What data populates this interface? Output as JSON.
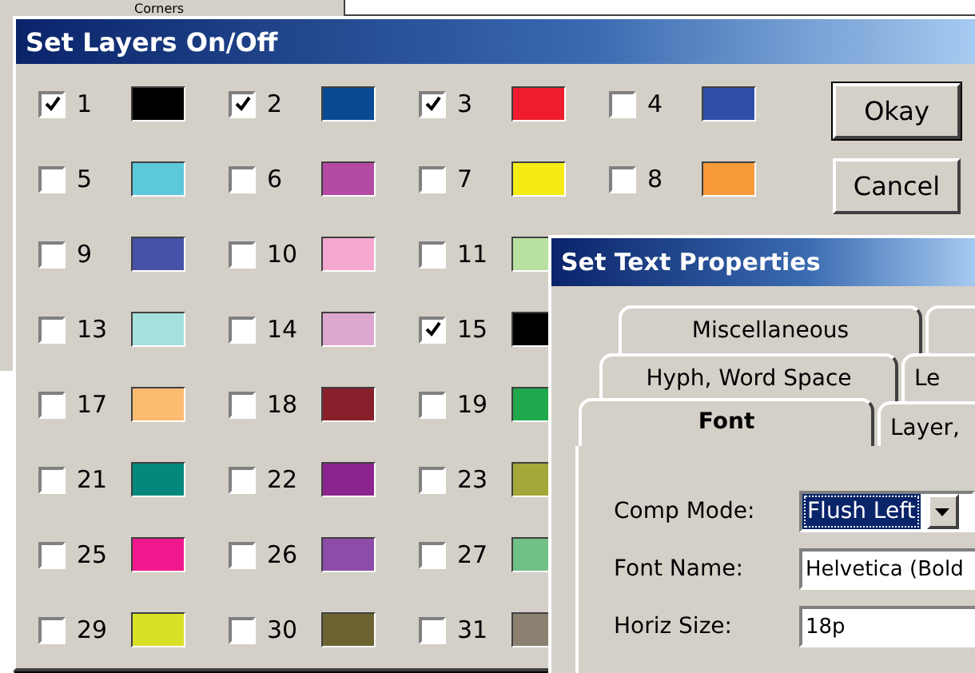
{
  "backdrop": {
    "label": "Corners"
  },
  "layers_dialog": {
    "title": "Set Layers On/Off",
    "rows": [
      [
        {
          "number": "1",
          "checked": true,
          "color": "#000000"
        },
        {
          "number": "2",
          "checked": true,
          "color": "#0a4a94"
        },
        {
          "number": "3",
          "checked": true,
          "color": "#ee1c2e"
        },
        {
          "number": "4",
          "checked": false,
          "color": "#2f4fa8"
        }
      ],
      [
        {
          "number": "5",
          "checked": false,
          "color": "#5cc8dc"
        },
        {
          "number": "6",
          "checked": false,
          "color": "#b44aa4"
        },
        {
          "number": "7",
          "checked": false,
          "color": "#f4ec14"
        },
        {
          "number": "8",
          "checked": false,
          "color": "#f89a3a"
        }
      ],
      [
        {
          "number": "9",
          "checked": false,
          "color": "#4652a8"
        },
        {
          "number": "10",
          "checked": false,
          "color": "#f4a8d0"
        },
        {
          "number": "11",
          "checked": false,
          "color": "#b8e0a0"
        }
      ],
      [
        {
          "number": "13",
          "checked": false,
          "color": "#a4e0dc"
        },
        {
          "number": "14",
          "checked": false,
          "color": "#dca8d0"
        },
        {
          "number": "15",
          "checked": true,
          "color": "#000000"
        }
      ],
      [
        {
          "number": "17",
          "checked": false,
          "color": "#fcbc70"
        },
        {
          "number": "18",
          "checked": false,
          "color": "#88202c"
        },
        {
          "number": "19",
          "checked": false,
          "color": "#20a84c"
        }
      ],
      [
        {
          "number": "21",
          "checked": false,
          "color": "#04887c"
        },
        {
          "number": "22",
          "checked": false,
          "color": "#8c2490"
        },
        {
          "number": "23",
          "checked": false,
          "color": "#a4a838"
        }
      ],
      [
        {
          "number": "25",
          "checked": false,
          "color": "#f0188c"
        },
        {
          "number": "26",
          "checked": false,
          "color": "#8c4ca8"
        },
        {
          "number": "27",
          "checked": false,
          "color": "#70c088"
        }
      ],
      [
        {
          "number": "29",
          "checked": false,
          "color": "#d8e028"
        },
        {
          "number": "30",
          "checked": false,
          "color": "#6c6430"
        },
        {
          "number": "31",
          "checked": false,
          "color": "#8c8070"
        }
      ]
    ],
    "buttons": [
      {
        "label": "Okay",
        "default": true
      },
      {
        "label": "Cancel",
        "default": false
      }
    ]
  },
  "text_dialog": {
    "title": "Set Text Properties",
    "tab_rows": [
      [
        {
          "label": "Miscellaneous",
          "selected": false
        },
        {
          "selected": false
        }
      ],
      [
        {
          "label": "Hyph, Word Space",
          "selected": false
        },
        {
          "label": "Le",
          "selected": false
        }
      ],
      [
        {
          "label": "Font",
          "selected": true
        },
        {
          "label": "Layer,",
          "selected": false
        }
      ]
    ],
    "fields": [
      {
        "label": "Comp Mode:",
        "kind": "dropdown",
        "value": "Flush Left"
      },
      {
        "label": "Font Name:",
        "kind": "text",
        "value": "Helvetica (Bold"
      },
      {
        "label": "Horiz Size:",
        "kind": "text",
        "value": "18p"
      }
    ]
  }
}
